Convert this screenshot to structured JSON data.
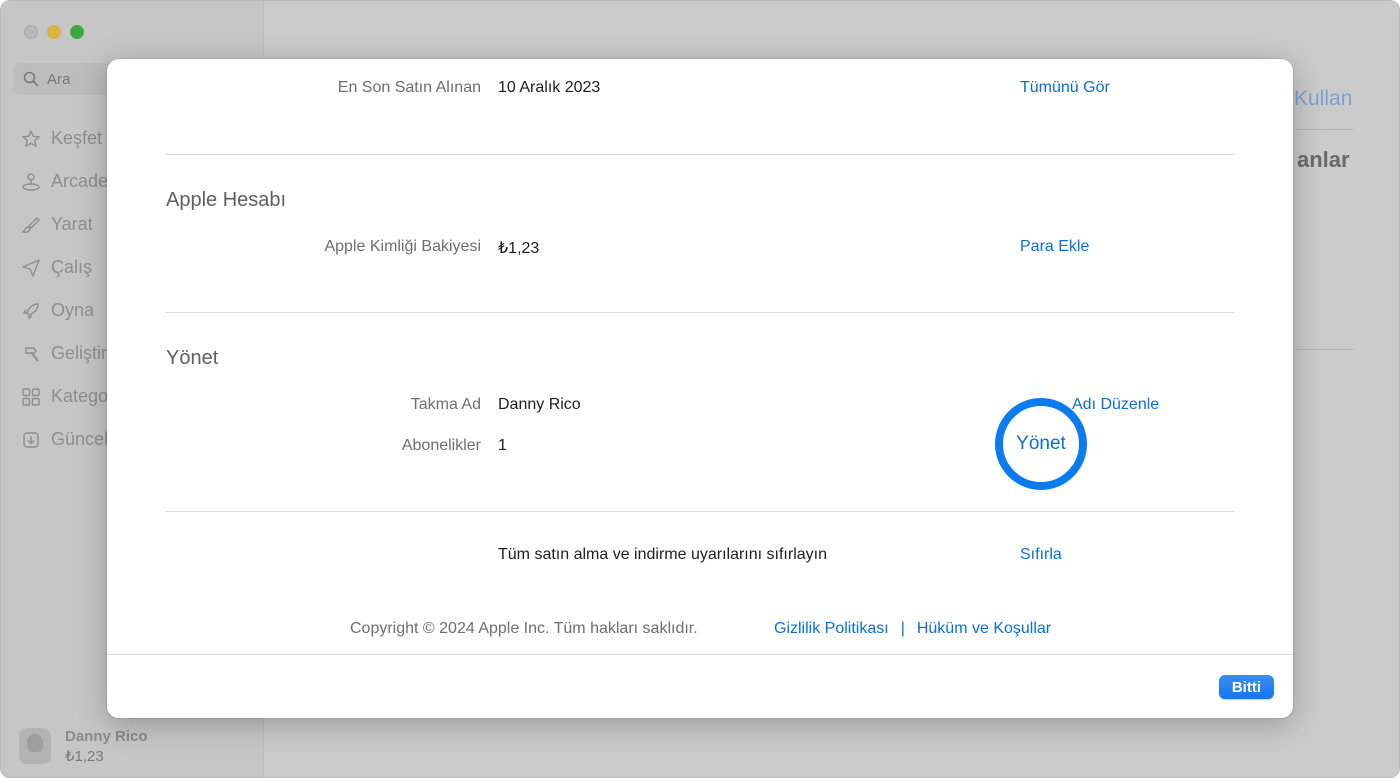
{
  "background": {
    "search_placeholder": "Ara",
    "sidebar": {
      "items": [
        {
          "label": "Keşfet",
          "icon": "star-icon"
        },
        {
          "label": "Arcade",
          "icon": "joystick-icon"
        },
        {
          "label": "Yarat",
          "icon": "brush-icon"
        },
        {
          "label": "Çalış",
          "icon": "paper-plane-icon"
        },
        {
          "label": "Oyna",
          "icon": "rocket-icon"
        },
        {
          "label": "Geliştir",
          "icon": "hammer-icon"
        },
        {
          "label": "Katego",
          "icon": "grid-icon"
        },
        {
          "label": "Güncel",
          "icon": "download-icon"
        }
      ]
    },
    "profile": {
      "name": "Danny Rico",
      "balance": "₺1,23"
    },
    "main": {
      "link": "Kullan",
      "heading": "anlar"
    }
  },
  "modal": {
    "last_purchase": {
      "label": "En Son Satın Alınan",
      "value": "10 Aralık 2023",
      "action": "Tümünü Gör"
    },
    "apple_account": {
      "title": "Apple Hesabı",
      "balance": {
        "label": "Apple Kimliği Bakiyesi",
        "value": "₺1,23",
        "action": "Para Ekle"
      }
    },
    "manage": {
      "title": "Yönet",
      "nickname": {
        "label": "Takma Ad",
        "value": "Danny Rico",
        "action": "Adı Düzenle"
      },
      "subscriptions": {
        "label": "Abonelikler",
        "value": "1",
        "action": "Yönet"
      }
    },
    "reset": {
      "text": "Tüm satın alma ve indirme uyarılarını sıfırlayın",
      "action": "Sıfırla"
    },
    "footer": {
      "copyright": "Copyright © 2024 Apple Inc. Tüm hakları saklıdır.",
      "privacy": "Gizlilik Politikası",
      "separator": "|",
      "terms": "Hüküm ve Koşullar"
    },
    "done_label": "Bitti"
  },
  "colors": {
    "accent": "#0a6fd8",
    "highlight_ring": "#0a7cf0",
    "done_button": "#1776ee"
  }
}
